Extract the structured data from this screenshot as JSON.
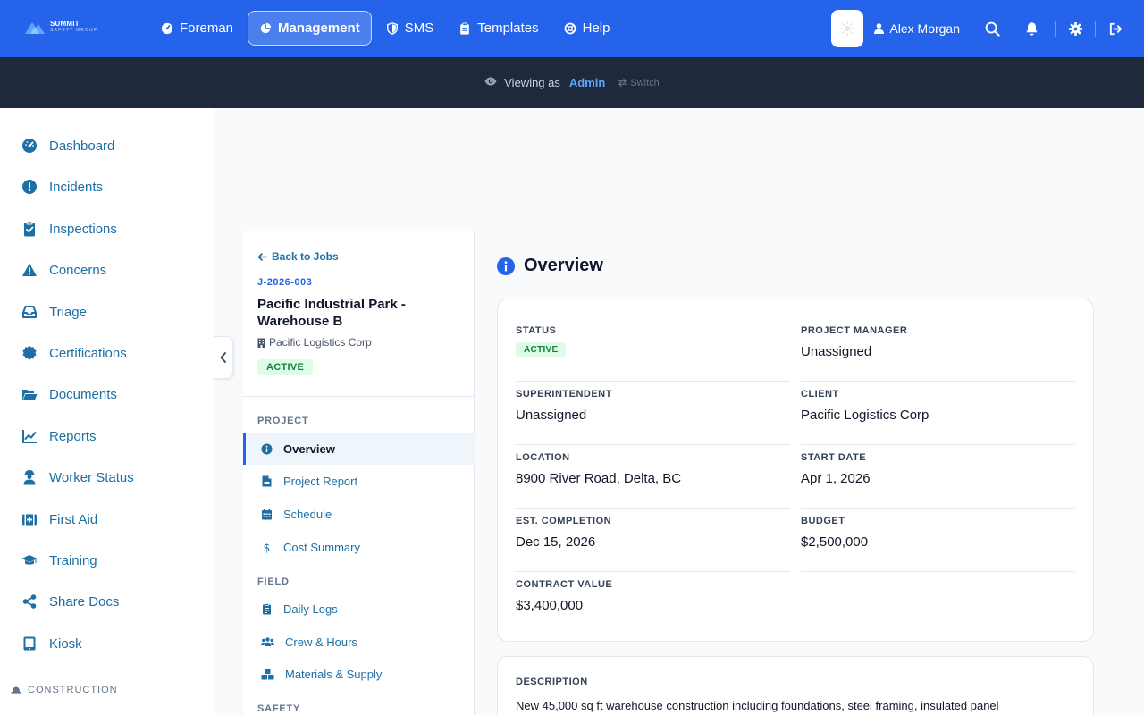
{
  "brand": {
    "name": "SUMMIT",
    "subtitle": "SAFETY GROUP"
  },
  "nav": {
    "tabs": [
      {
        "label": "Foreman",
        "icon": "gauge-icon"
      },
      {
        "label": "Management",
        "icon": "chart-pie-icon",
        "active": true
      },
      {
        "label": "SMS",
        "icon": "shield-icon"
      },
      {
        "label": "Templates",
        "icon": "clipboard-icon"
      },
      {
        "label": "Help",
        "icon": "life-ring-icon"
      }
    ],
    "user": "Alex Morgan"
  },
  "viewbar": {
    "prefix": "Viewing as",
    "role": "Admin",
    "switch": "Switch"
  },
  "sidebar": {
    "items": [
      {
        "label": "Dashboard",
        "icon": "gauge-icon"
      },
      {
        "label": "Incidents",
        "icon": "exclamation-circle-icon"
      },
      {
        "label": "Inspections",
        "icon": "clipboard-check-icon"
      },
      {
        "label": "Concerns",
        "icon": "warning-triangle-icon"
      },
      {
        "label": "Triage",
        "icon": "inbox-icon"
      },
      {
        "label": "Certifications",
        "icon": "certificate-icon"
      },
      {
        "label": "Documents",
        "icon": "folder-open-icon"
      },
      {
        "label": "Reports",
        "icon": "line-chart-icon"
      },
      {
        "label": "Worker Status",
        "icon": "worker-icon"
      },
      {
        "label": "First Aid",
        "icon": "medkit-icon"
      },
      {
        "label": "Training",
        "icon": "graduation-cap-icon"
      },
      {
        "label": "Share Docs",
        "icon": "share-icon"
      },
      {
        "label": "Kiosk",
        "icon": "tablet-icon"
      }
    ],
    "section": "CONSTRUCTION"
  },
  "job": {
    "back": "Back to Jobs",
    "code": "J-2026-003",
    "title": "Pacific Industrial Park - Warehouse B",
    "client": "Pacific Logistics Corp",
    "status": "ACTIVE",
    "groups": [
      {
        "label": "PROJECT",
        "items": [
          {
            "label": "Overview",
            "icon": "info-circle-icon",
            "active": true
          },
          {
            "label": "Project Report",
            "icon": "file-pdf-icon"
          },
          {
            "label": "Schedule",
            "icon": "calendar-icon"
          },
          {
            "label": "Cost Summary",
            "icon": "dollar-icon"
          }
        ]
      },
      {
        "label": "FIELD",
        "items": [
          {
            "label": "Daily Logs",
            "icon": "clipboard-list-icon"
          },
          {
            "label": "Crew & Hours",
            "icon": "users-icon"
          },
          {
            "label": "Materials & Supply",
            "icon": "boxes-icon"
          }
        ]
      },
      {
        "label": "SAFETY",
        "items": []
      }
    ]
  },
  "overview": {
    "title": "Overview",
    "fields": {
      "status": {
        "label": "STATUS",
        "value": "ACTIVE"
      },
      "project_manager": {
        "label": "PROJECT MANAGER",
        "value": "Unassigned"
      },
      "superintendent": {
        "label": "SUPERINTENDENT",
        "value": "Unassigned"
      },
      "client": {
        "label": "CLIENT",
        "value": "Pacific Logistics Corp"
      },
      "location": {
        "label": "LOCATION",
        "value": "8900 River Road, Delta, BC"
      },
      "start_date": {
        "label": "START DATE",
        "value": "Apr 1, 2026"
      },
      "est_completion": {
        "label": "EST. COMPLETION",
        "value": "Dec 15, 2026"
      },
      "budget": {
        "label": "BUDGET",
        "value": "$2,500,000"
      },
      "contract_value": {
        "label": "CONTRACT VALUE",
        "value": "$3,400,000"
      }
    },
    "description": {
      "label": "DESCRIPTION",
      "value": "New 45,000 sq ft warehouse construction including foundations, steel framing, insulated panel"
    }
  },
  "colors": {
    "primary": "#2563eb",
    "sidebar_link": "#1d6fa5",
    "dark_bar": "#1e293b",
    "active_badge_bg": "#dcfce7",
    "active_badge_text": "#15803d"
  }
}
